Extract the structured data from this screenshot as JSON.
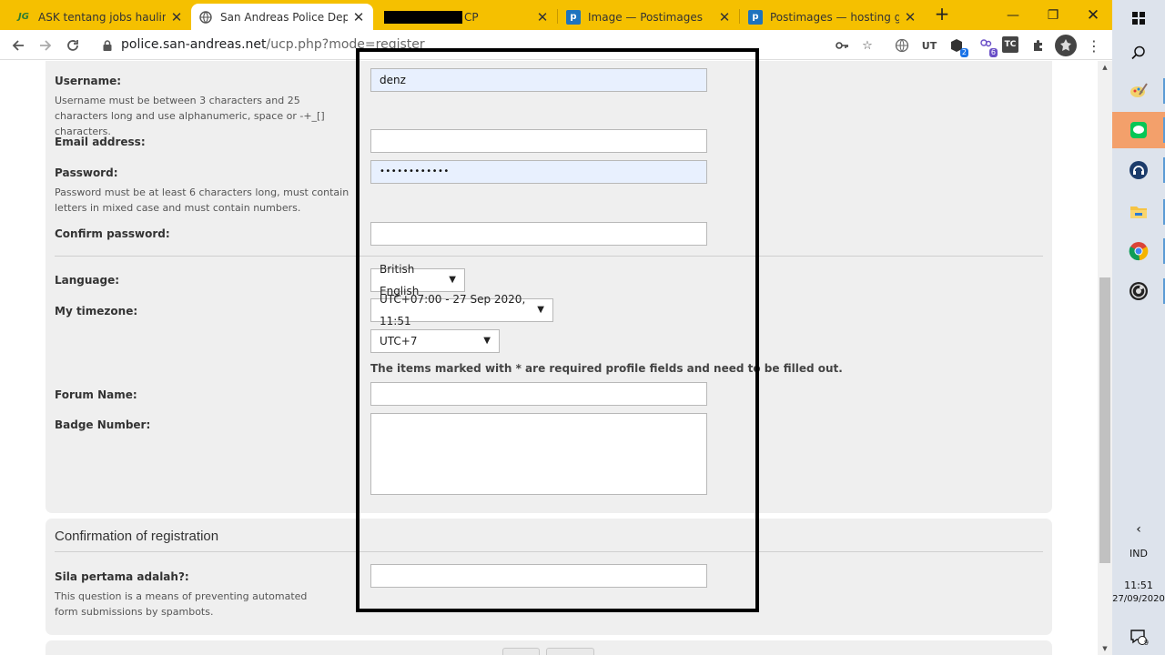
{
  "browser": {
    "tabs": [
      {
        "title": "ASK tentang jobs hauling - P",
        "favicon": "JG",
        "active": false
      },
      {
        "title": "San Andreas Police Departm",
        "favicon": "globe-icon",
        "active": true
      },
      {
        "title": "CP",
        "favicon": "redacted",
        "active": false
      },
      {
        "title": "Image — Postimages",
        "favicon": "p",
        "active": false
      },
      {
        "title": "Postimages — hosting gamb",
        "favicon": "p",
        "active": false
      }
    ],
    "url_host": "police.san-andreas.net",
    "url_path": "/ucp.php?mode=register",
    "extension_badges": [
      "2",
      "6"
    ],
    "extension_labels": {
      "ut": "UT",
      "tc": "TC"
    }
  },
  "form": {
    "username": {
      "label": "Username:",
      "hint": "Username must be between 3 characters and 25 characters long and use alphanumeric, space or -+_[] characters.",
      "value": "denz"
    },
    "email": {
      "label": "Email address:",
      "value": ""
    },
    "password": {
      "label": "Password:",
      "hint": "Password must be at least 6 characters long, must contain letters in mixed case and must contain numbers.",
      "value": "••••••••••••"
    },
    "confirm": {
      "label": "Confirm password:",
      "value": ""
    },
    "language": {
      "label": "Language:",
      "value": "British English"
    },
    "timezone": {
      "label": "My timezone:",
      "value": "UTC+07:00 - 27 Sep 2020, 11:51",
      "zone": "UTC+7"
    },
    "notice": "The items marked with * are required profile fields and need to be filled out.",
    "forum_name": {
      "label": "Forum Name:",
      "value": ""
    },
    "badge_number": {
      "label": "Badge Number:",
      "value": ""
    }
  },
  "confirmation": {
    "title": "Confirmation of registration",
    "question_label": "Sila pertama adalah?:",
    "question_hint": "This question is a means of preventing automated form submissions by spambots.",
    "answer": ""
  },
  "taskbar": {
    "language": "IND",
    "time": "11:51",
    "date": "27/09/2020",
    "notifications": "9"
  },
  "colors": {
    "tabstrip": "#f5c000",
    "panel": "#efefef",
    "autofill": "#e8f0fe",
    "taskbar": "#dde3ec",
    "highlight_app": "#f3a06b"
  }
}
